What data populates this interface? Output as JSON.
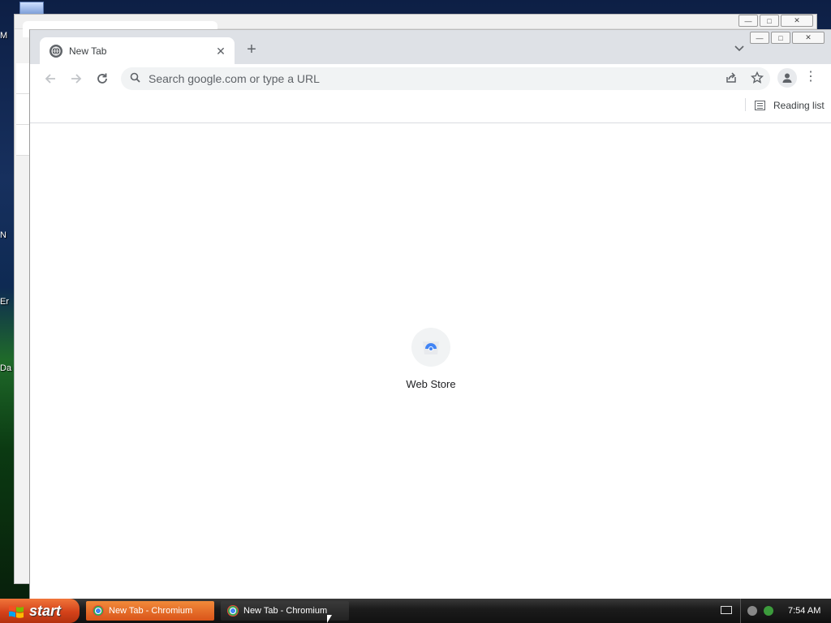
{
  "desktop": {
    "icons": [
      {
        "label": "M"
      },
      {
        "label": "N"
      },
      {
        "label": "Er"
      },
      {
        "label": "Da"
      }
    ]
  },
  "browser": {
    "tab": {
      "title": "New Tab"
    },
    "omnibox": {
      "placeholder": "Search google.com or type a URL"
    },
    "bookmarks": {
      "reading_list": "Reading list"
    },
    "shortcuts": [
      {
        "label": "Web Store"
      }
    ]
  },
  "taskbar": {
    "start_label": "start",
    "tasks": [
      {
        "label": "New Tab - Chromium",
        "active": true
      },
      {
        "label": "New Tab - Chromium",
        "active": false
      }
    ],
    "clock": "7:54 AM"
  },
  "colors": {
    "tabstrip": "#dee1e6",
    "omnibox": "#f1f3f4",
    "start_button": "#d4421a",
    "taskbar": "#1c1c1c"
  },
  "icons": [
    "globe-icon",
    "close-icon",
    "plus-icon",
    "chevron-down-icon",
    "back-arrow-icon",
    "forward-arrow-icon",
    "reload-icon",
    "search-icon",
    "share-icon",
    "star-icon",
    "profile-icon",
    "kebab-menu-icon",
    "reading-list-icon",
    "web-store-icon",
    "windows-flag-icon",
    "chromium-icon",
    "keyboard-icon",
    "network-icon",
    "clock"
  ]
}
